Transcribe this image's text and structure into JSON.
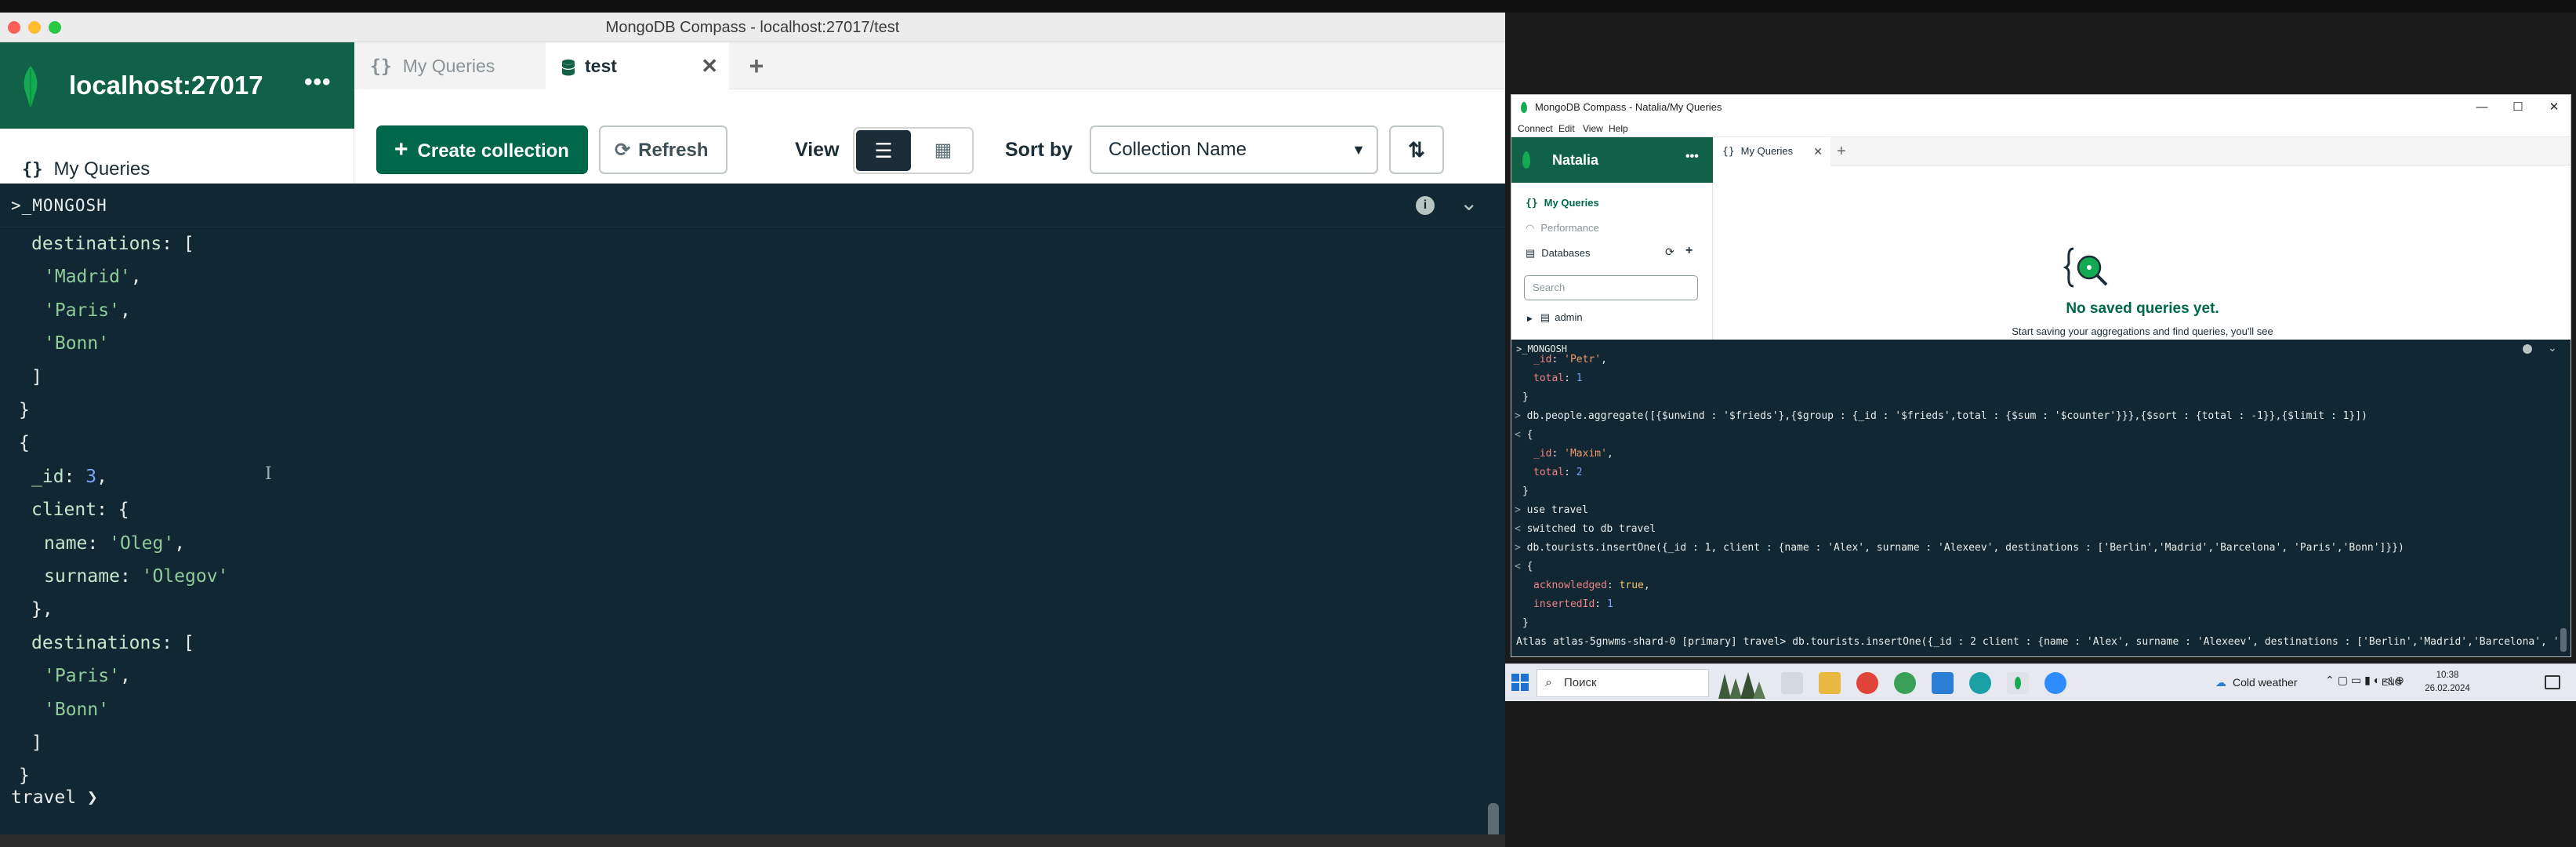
{
  "left_window": {
    "title": "MongoDB Compass - localhost:27017/test",
    "connection": "localhost:27017",
    "menu_dots": "•••",
    "sidebar": {
      "my_queries_icon": "{}",
      "my_queries": "My Queries"
    },
    "tabs": [
      {
        "icon": "{}",
        "label": "My Queries"
      },
      {
        "icon": "database-icon",
        "label": "test"
      }
    ],
    "tab_close": "✕",
    "tab_add": "+",
    "toolbar": {
      "create": "Create collection",
      "refresh": "Refresh",
      "view_label": "View",
      "sort_label": "Sort by",
      "sort_value": "Collection Name"
    },
    "shell": {
      "title": ">_MONGOSH",
      "prompt": "travel",
      "prompt_arrow": "❯"
    }
  },
  "right_window": {
    "title": "MongoDB Compass - Natalia/My Queries",
    "window_controls": {
      "min": "—",
      "max": "☐",
      "close": "✕"
    },
    "menu": [
      "Connect",
      "Edit",
      "View",
      "Help"
    ],
    "user": "Natalia",
    "menu_dots": "•••",
    "sidebar": {
      "my_queries": "My Queries",
      "performance": "Performance",
      "databases": "Databases",
      "search_placeholder": "Search",
      "db_item": "admin"
    },
    "tab": "My Queries",
    "tab_close": "✕",
    "tab_add": "+",
    "empty_title": "No saved queries yet.",
    "empty_sub": "Start saving your aggregations and find queries, you'll see",
    "shell": {
      "title": ">_MONGOSH",
      "prompt_line": "Atlas atlas-5gnwms-shard-0 [primary] travel> db.tourists.insertOne({_id : 2 client : {name : 'Alex', surname : 'Alexeev', destinations : ['Berlin','Madrid','Barcelona', '"
    }
  },
  "taskbar": {
    "search": "Поиск",
    "weather": "Cold weather",
    "lang": "ENG",
    "time": "10:38",
    "date": "26.02.2024"
  },
  "colors": {
    "brand_green": "#00684a",
    "sidebar_green": "#116149",
    "shell_bg": "#112733"
  }
}
